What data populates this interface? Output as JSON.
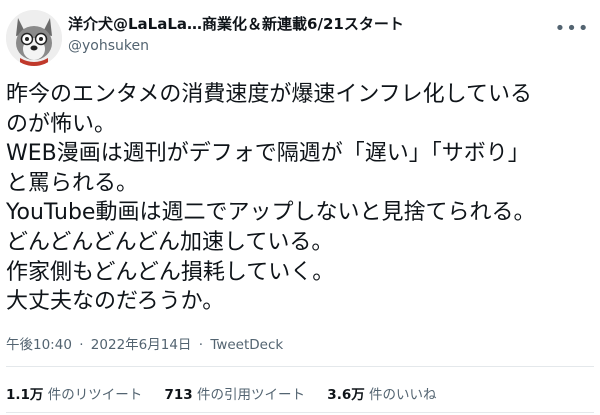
{
  "header": {
    "display_name": "洋介犬@LaLaLa…商業化＆新連載6/21スタート",
    "handle": "@yohsuken",
    "more_icon": "more-horizontal-icon"
  },
  "tweet": {
    "lines": [
      "昨今のエンタメの消費速度が爆速インフレ化している",
      "のが怖い。",
      "WEB漫画は週刊がデフォで隔週が「遅い」「サボり」",
      "と罵られる。",
      "YouTube動画は週二でアップしないと見捨てられる。",
      "どんどんどんどん加速している。",
      "作家側もどんどん損耗していく。",
      "大丈夫なのだろうか。"
    ]
  },
  "meta": {
    "time": "午後10:40",
    "separator": "·",
    "date": "2022年6月14日",
    "source": "TweetDeck"
  },
  "stats": {
    "retweets_count": "1.1万",
    "retweets_label": "件のリツイート",
    "quotes_count": "713",
    "quotes_label": "件の引用ツイート",
    "likes_count": "3.6万",
    "likes_label": "件のいいね"
  }
}
